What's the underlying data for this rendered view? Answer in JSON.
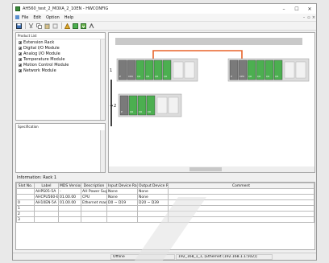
{
  "window": {
    "title": "AH560_test_2_MOXA_2_10EN - HWCONFIG",
    "controls": {
      "minimize": "–",
      "maximize": "☐",
      "close": "✕"
    }
  },
  "menu": {
    "items": [
      "File",
      "Edit",
      "Option",
      "Help"
    ],
    "mdi_controls": [
      "–",
      "▫",
      "×"
    ]
  },
  "toolbar": {
    "buttons": [
      "save-icon",
      "cut-icon",
      "copy-icon",
      "paste-icon",
      "delete-icon",
      "online-icon",
      "upload-icon",
      "download-icon",
      "network-icon"
    ]
  },
  "product_list": {
    "header": "Product List",
    "items": [
      "Extension Rack",
      "Digital I/O Module",
      "Analog I/O Module",
      "Temperature Module",
      "Motion Control Module",
      "Network Module"
    ]
  },
  "specification": {
    "header": "Specification"
  },
  "design": {
    "rack1_label": "1",
    "rack2_label": "2",
    "rack2_arrow": "→",
    "module_labels": [
      "P",
      "CPU",
      "I/O",
      "I/O",
      "I/O",
      "I/O"
    ],
    "rack2_module_labels": [
      "P",
      "I/O",
      "I/O",
      "I/O"
    ],
    "link_color": "#e8632a",
    "module_green": "#4caf50",
    "module_gray": "#7a7a7a"
  },
  "info": {
    "text": "Information: Rack 1"
  },
  "table": {
    "columns": [
      "Slot No.",
      "Label",
      "MDS Version",
      "Description",
      "Input Device Ran...",
      "Output Device Ra...",
      "Comment"
    ],
    "rows": [
      [
        "",
        "AHPS05-5A",
        "-",
        "AH Power Supp",
        "None",
        "None",
        ""
      ],
      [
        "",
        "AHCPU560-E",
        "01.00.00",
        "CPU",
        "None",
        "None",
        ""
      ],
      [
        "0",
        "AH10EN-5A",
        "01.00.00",
        "Ethernet master",
        "D0 ~ D19",
        "D20 ~ D39",
        ""
      ],
      [
        "1",
        "",
        "",
        "",
        "",
        "",
        ""
      ],
      [
        "2",
        "",
        "",
        "",
        "",
        "",
        ""
      ],
      [
        "3",
        "",
        "",
        "",
        "",
        "",
        ""
      ]
    ]
  },
  "status": {
    "mode": "Offline",
    "connection": "192_168_1_1, [Ethernet (192.168.1.1:502)]"
  }
}
